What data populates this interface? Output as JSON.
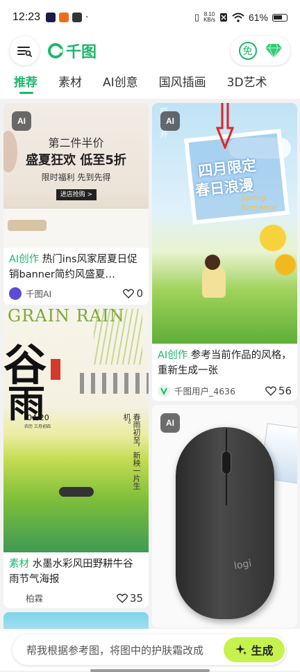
{
  "status": {
    "time": "12:23",
    "netspeed_value": "8.10",
    "netspeed_unit": "KB/s",
    "battery": "61%"
  },
  "header": {
    "logo_text": "千图",
    "free_label": "免"
  },
  "tabs": [
    {
      "label": "推荐",
      "active": true
    },
    {
      "label": "素材"
    },
    {
      "label": "AI创意"
    },
    {
      "label": "国风插画"
    },
    {
      "label": "3D艺术"
    }
  ],
  "cards": [
    {
      "ai_badge": "AI",
      "image_text": {
        "line1": "第二件半价",
        "line2": "盛夏狂欢 低至5折",
        "line3": "限时福利 先到先得",
        "button": "进店抢购 >"
      },
      "tag": "AI创作",
      "title": " 热门ins风家居夏日促销banner简约风盛夏…",
      "author": "千图AI",
      "likes": "0"
    },
    {
      "ai_badge": "AI",
      "image_text": {
        "line1": "四月限定",
        "line2": "春日浪漫",
        "side": "四月花开",
        "script": "Spring Romance"
      },
      "tag": "AI创作",
      "title": " 参考当前作品的风格，重新生成一张",
      "author": "千图用户_4636",
      "likes": "56"
    },
    {
      "image_text": {
        "headline": "GRAIN RAIN",
        "big1": "谷",
        "big2": "雨",
        "date": "04/20",
        "date_sub": "农历 三月初四",
        "poem": "春雨初至，新秧一片生机。"
      },
      "tag": "素材",
      "title": " 水墨水彩风田野耕牛谷雨节气海报",
      "author": "柏霖",
      "likes": "35"
    },
    {
      "ai_badge": "AI",
      "image_text": {
        "brand": "logi"
      }
    }
  ],
  "bottom": {
    "placeholder": "帮我根据参考图，将图中的护肤霜改成",
    "generate_label": "生成"
  },
  "colors": {
    "accent": "#1db86a",
    "generate_bg": "#c6f24e"
  }
}
